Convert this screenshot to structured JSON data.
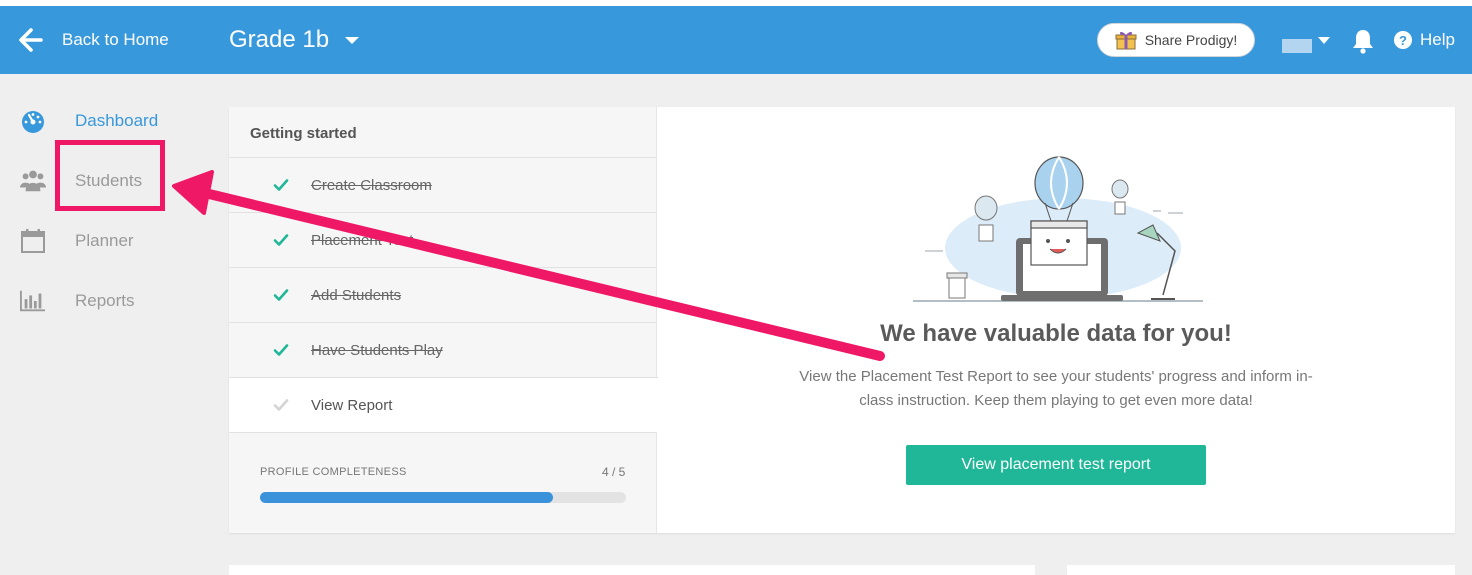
{
  "header": {
    "back_label": "Back to Home",
    "class_name": "Grade 1b",
    "share_label": "Share Prodigy!",
    "help_label": "Help"
  },
  "sidebar": {
    "items": [
      {
        "label": "Dashboard",
        "icon": "dashboard-gauge-icon",
        "active": true
      },
      {
        "label": "Students",
        "icon": "students-icon",
        "active": false
      },
      {
        "label": "Planner",
        "icon": "calendar-icon",
        "active": false
      },
      {
        "label": "Reports",
        "icon": "bar-chart-icon",
        "active": false
      }
    ]
  },
  "getting_started": {
    "title": "Getting started",
    "steps": [
      {
        "label": "Create Classroom",
        "done": true
      },
      {
        "label": "Placement Test",
        "done": true
      },
      {
        "label": "Add Students",
        "done": true
      },
      {
        "label": "Have Students Play",
        "done": true
      },
      {
        "label": "View Report",
        "done": false
      }
    ],
    "progress": {
      "label": "PROFILE COMPLETENESS",
      "count": "4 / 5",
      "fraction": 0.8
    }
  },
  "main": {
    "headline": "We have valuable data for you!",
    "description": "View the Placement Test Report to see your students' progress and inform in-class instruction. Keep them playing to get even more data!",
    "button_label": "View placement test report"
  },
  "colors": {
    "header_blue": "#3898dc",
    "accent_green": "#1fb797",
    "check_green": "#1fb797",
    "highlight_pink": "#ef1866"
  }
}
